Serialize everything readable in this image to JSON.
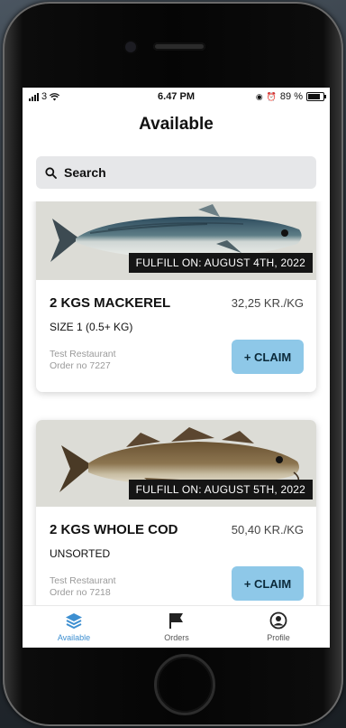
{
  "status": {
    "carrier": "3",
    "time": "6.47 PM",
    "battery": "89 %"
  },
  "page_title": "Available",
  "search": {
    "label": "Search"
  },
  "listings": [
    {
      "fulfill": "FULFILL ON: AUGUST 4TH, 2022",
      "title": "2 KGS MACKEREL",
      "price": "32,25 KR./KG",
      "subtitle": "SIZE 1 (0.5+ KG)",
      "restaurant": "Test Restaurant",
      "order": "Order no 7227",
      "claim_label": "+ CLAIM"
    },
    {
      "fulfill": "FULFILL ON: AUGUST 5TH, 2022",
      "title": "2 KGS WHOLE COD",
      "price": "50,40 KR./KG",
      "subtitle": "UNSORTED",
      "restaurant": "Test Restaurant",
      "order": "Order no 7218",
      "claim_label": "+ CLAIM"
    }
  ],
  "tabs": [
    {
      "label": "Available",
      "icon": "layers-icon",
      "active": true
    },
    {
      "label": "Orders",
      "icon": "flag-icon",
      "active": false
    },
    {
      "label": "Profile",
      "icon": "user-circle-icon",
      "active": false
    }
  ],
  "colors": {
    "accent": "#3d8fd1",
    "claim_button": "#8ec8e8",
    "banner": "#151515"
  }
}
